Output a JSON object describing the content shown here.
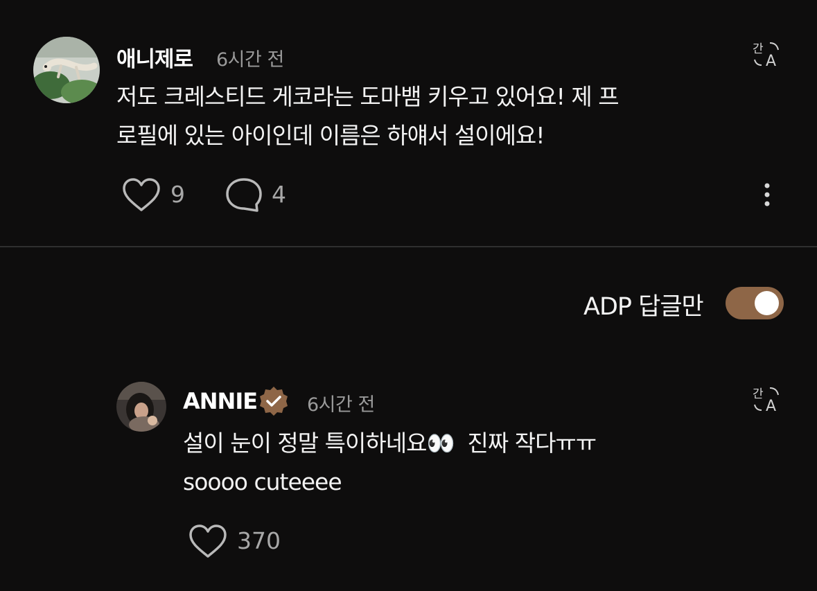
{
  "comment": {
    "username": "애니제로",
    "time": "6시간 전",
    "text": "저도 크레스티드 게코라는 도마뱀 키우고 있어요! 제 프\n로필에 있는 아이인데 이름은 하얘서 설이에요!",
    "likes": "9",
    "replies": "4",
    "translate_icon": "translate-icon",
    "more_icon": "more-vertical-icon"
  },
  "filter": {
    "label": "ADP 답글만",
    "enabled": true,
    "accent": "#8e6647"
  },
  "reply": {
    "username": "ANNIE",
    "verified_icon": "verified-badge-icon",
    "time": "6시간 전",
    "text_line1": "설이 눈이 정말 특이하네요",
    "eyes": "👀",
    "text_line1_tail": "  진짜 작다ㅠㅠ",
    "text_line2": "soooo cuteeee",
    "likes": "370",
    "badge_color": "#8e6647"
  }
}
